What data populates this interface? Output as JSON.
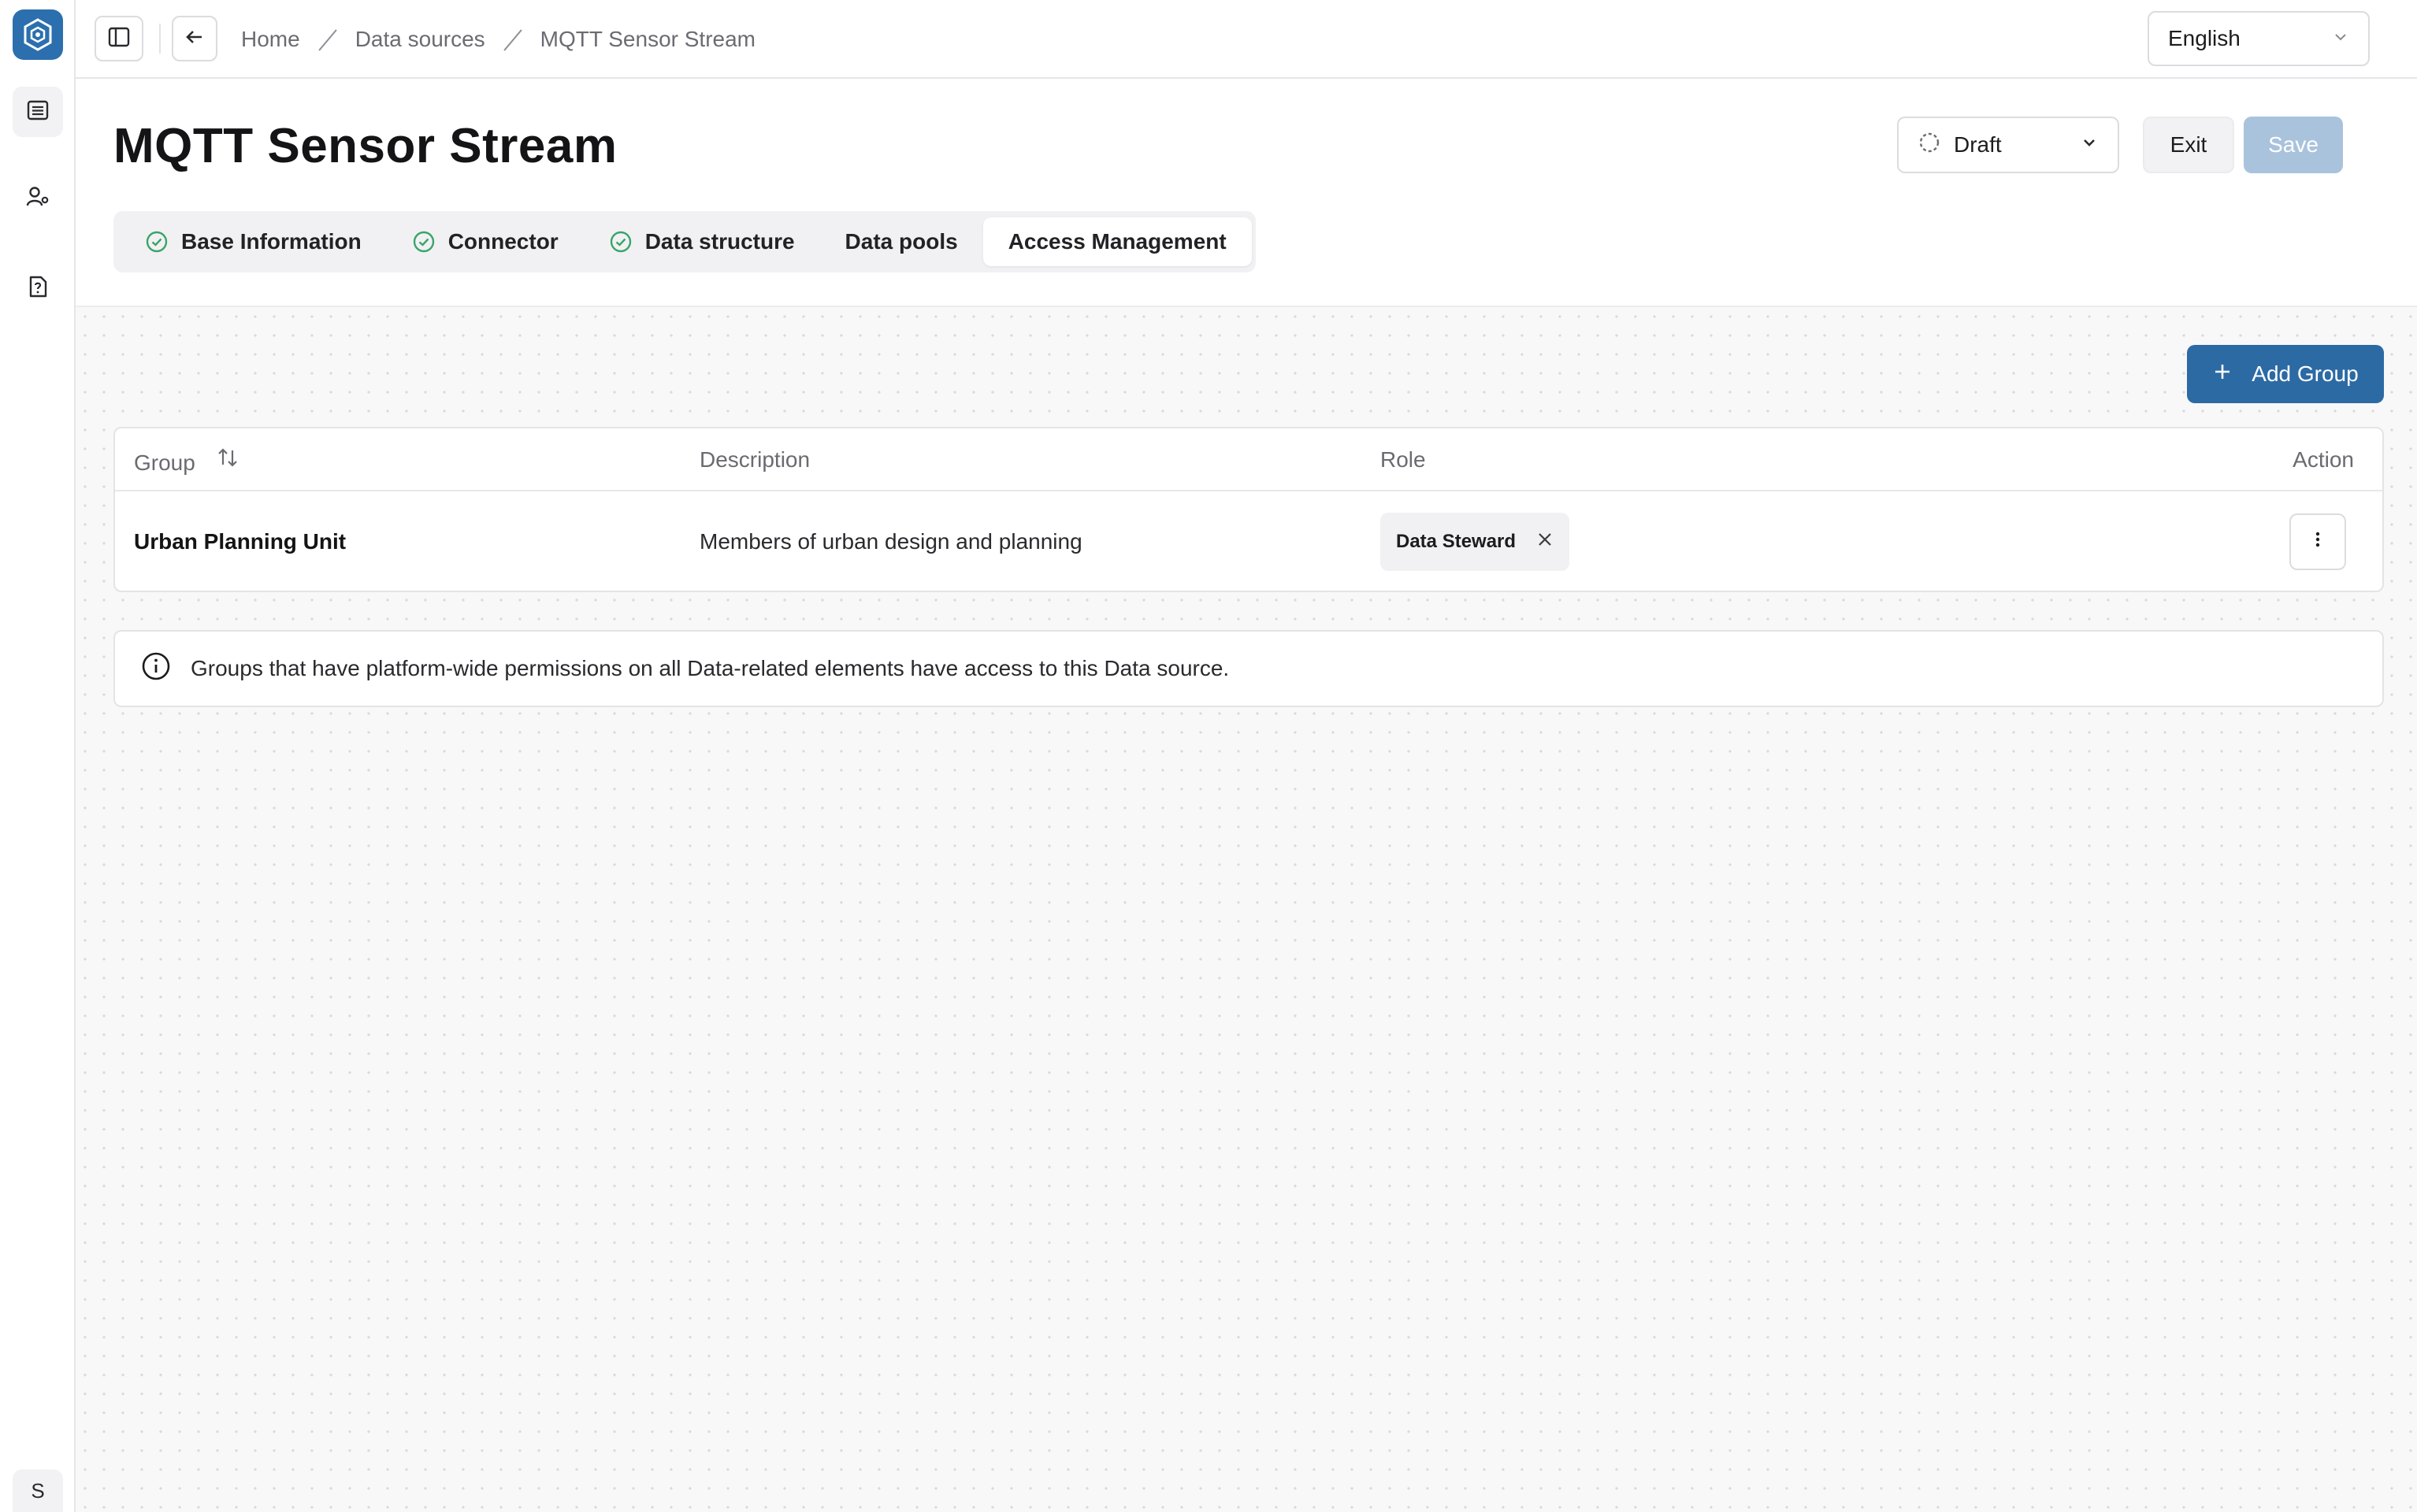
{
  "sidebar": {
    "items": [
      {
        "name": "data-sources",
        "icon": "list-icon",
        "active": true
      },
      {
        "name": "user-management",
        "icon": "user-settings-icon",
        "active": false
      },
      {
        "name": "help",
        "icon": "help-document-icon",
        "active": false
      }
    ],
    "user_initial": "S"
  },
  "topbar": {
    "breadcrumb": [
      "Home",
      "Data sources",
      "MQTT Sensor Stream"
    ],
    "language": "English"
  },
  "header": {
    "title": "MQTT Sensor Stream",
    "status": "Draft",
    "exit_label": "Exit",
    "save_label": "Save"
  },
  "tabs": [
    {
      "label": "Base Information",
      "completed": true,
      "active": false
    },
    {
      "label": "Connector",
      "completed": true,
      "active": false
    },
    {
      "label": "Data structure",
      "completed": true,
      "active": false
    },
    {
      "label": "Data pools",
      "completed": false,
      "active": false
    },
    {
      "label": "Access Management",
      "completed": false,
      "active": true
    }
  ],
  "access": {
    "add_group_label": "Add Group",
    "columns": {
      "group": "Group",
      "description": "Description",
      "role": "Role",
      "action": "Action"
    },
    "rows": [
      {
        "group": "Urban Planning Unit",
        "description": "Members of urban design and planning",
        "role": "Data Steward"
      }
    ],
    "info_text": "Groups that have platform-wide permissions on all Data-related elements have access to this Data source."
  },
  "colors": {
    "primary": "#2c6aa4",
    "save_disabled": "#a9c3dc",
    "check": "#3aa46a"
  }
}
